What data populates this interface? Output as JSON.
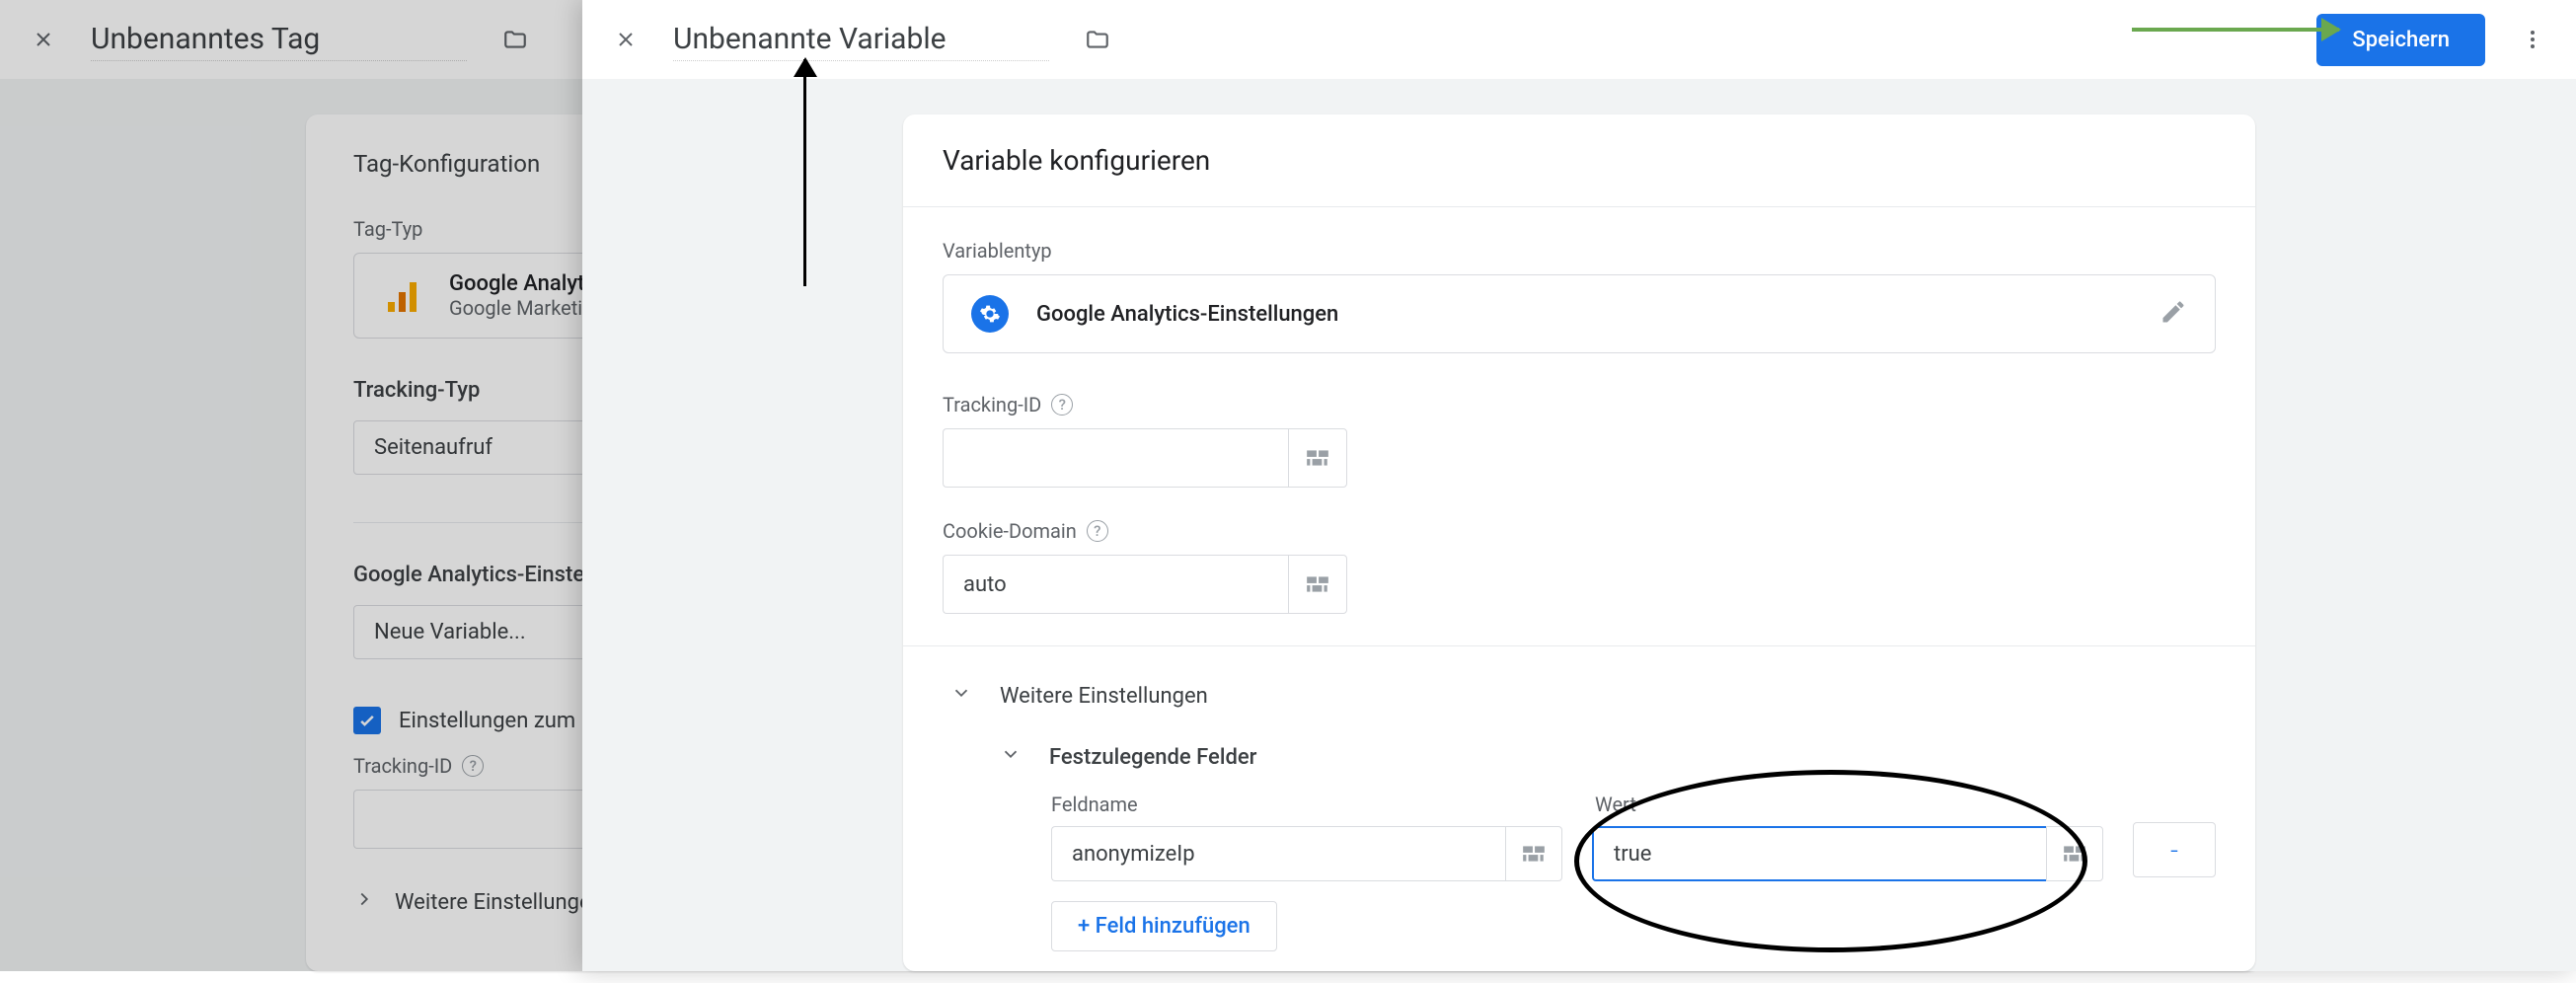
{
  "back": {
    "title": "Unbenanntes Tag",
    "card_title": "Tag-Konfiguration",
    "tag_type_label": "Tag-Typ",
    "tag_type_name": "Google Analytics: Universal Analytics",
    "tag_type_sub": "Google Marketing Platform",
    "tracking_type_label": "Tracking-Typ",
    "tracking_type_value": "Seitenaufruf",
    "ga_settings_label": "Google Analytics-Einstellungen",
    "ga_settings_value": "Neue Variable...",
    "override_checkbox": "Einstellungen zum Überschreiben in diesem Tag aktivieren",
    "tracking_id_label": "Tracking-ID",
    "more_settings": "Weitere Einstellungen"
  },
  "front": {
    "title": "Unbenannte Variable",
    "save_btn": "Speichern",
    "card_title": "Variable konfigurieren",
    "var_type_label": "Variablentyp",
    "var_type_name": "Google Analytics-Einstellungen",
    "tracking_id_label": "Tracking-ID",
    "tracking_id_value": "",
    "cookie_domain_label": "Cookie-Domain",
    "cookie_domain_value": "auto",
    "more_settings": "Weitere Einstellungen",
    "fields_to_set": "Festzulegende Felder",
    "field_name_label": "Feldname",
    "field_value_label": "Wert",
    "field_name_value": "anonymizeIp",
    "field_value_value": "true",
    "remove_btn": "-",
    "add_field_btn": "+ Feld hinzufügen"
  }
}
